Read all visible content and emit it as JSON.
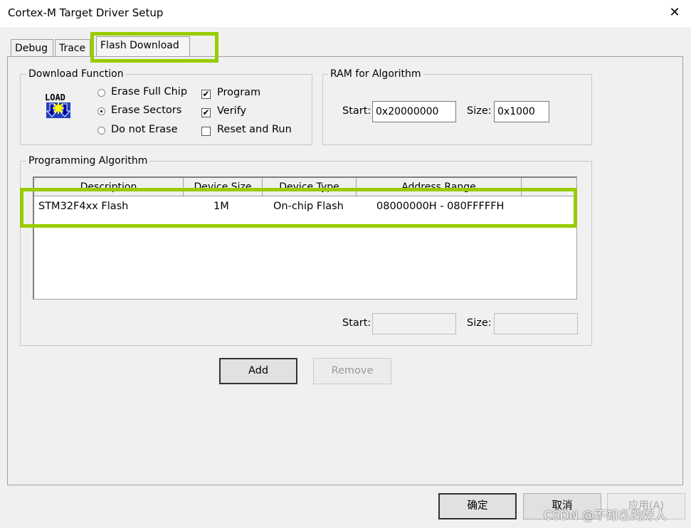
{
  "window": {
    "title": "Cortex-M Target Driver Setup",
    "close": "✕"
  },
  "tabs": [
    {
      "label": "Debug"
    },
    {
      "label": "Trace"
    },
    {
      "label": "Flash Download"
    }
  ],
  "download_function": {
    "title": "Download Function",
    "icon": "LOAD",
    "erase_full_chip": "Erase Full Chip",
    "erase_sectors": "Erase Sectors",
    "do_not_erase": "Do not Erase",
    "selected_erase": "Erase Sectors",
    "program": {
      "label": "Program",
      "checked": true
    },
    "verify": {
      "label": "Verify",
      "checked": true
    },
    "reset_and_run": {
      "label": "Reset and Run",
      "checked": false
    }
  },
  "ram": {
    "title": "RAM for Algorithm",
    "start_label": "Start:",
    "start_value": "0x20000000",
    "size_label": "Size:",
    "size_value": "0x1000"
  },
  "algorithm": {
    "title": "Programming Algorithm",
    "columns": [
      "Description",
      "Device Size",
      "Device Type",
      "Address Range"
    ],
    "rows": [
      {
        "description": "STM32F4xx Flash",
        "size": "1M",
        "type": "On-chip Flash",
        "range": "08000000H - 080FFFFFH"
      }
    ],
    "start_label": "Start:",
    "start_value": "",
    "size_label": "Size:",
    "size_value": ""
  },
  "buttons": {
    "add": "Add",
    "remove": "Remove",
    "ok": "确定",
    "cancel": "取消",
    "apply": "应用(A)"
  },
  "watermark": "CSDN @不知名的好人",
  "colors": {
    "highlight": "#99cc00"
  }
}
